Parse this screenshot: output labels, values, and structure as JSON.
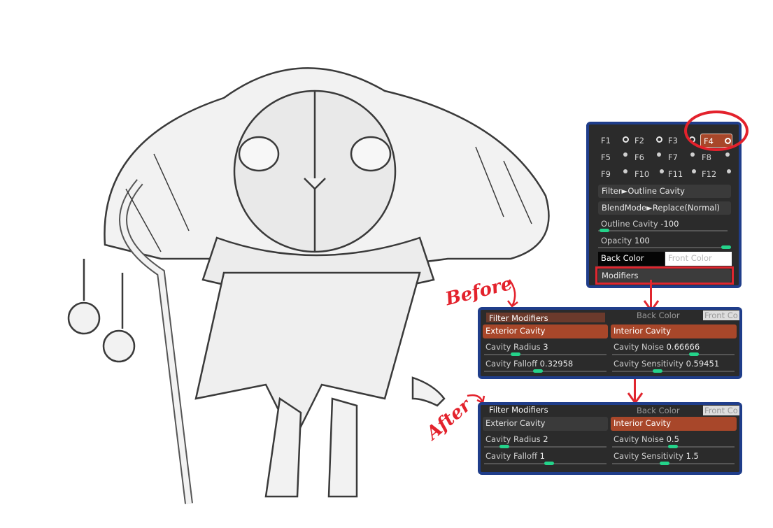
{
  "filter_panel": {
    "keys": [
      "F1",
      "F2",
      "F3",
      "F4",
      "F5",
      "F6",
      "F7",
      "F8",
      "F9",
      "F10",
      "F11",
      "F12"
    ],
    "filter": "Filter►Outline Cavity",
    "blendmode": "BlendMode►Replace(Normal)",
    "outline_label": "Outline Cavity",
    "outline_value": "-100",
    "opacity_label": "Opacity",
    "opacity_value": "100",
    "back_color": "Back Color",
    "front_color": "Front Color",
    "modifiers": "Modifiers"
  },
  "before": {
    "annotation": "Before",
    "ghost_back": "Back Color",
    "ghost_front": "Front Co",
    "title": "Filter Modifiers",
    "exterior": "Exterior Cavity",
    "interior": "Interior Cavity",
    "radius_label": "Cavity Radius",
    "radius_value": "3",
    "noise_label": "Cavity Noise",
    "noise_value": "0.66666",
    "falloff_label": "Cavity Falloff",
    "falloff_value": "0.32958",
    "sensitivity_label": "Cavity Sensitivity",
    "sensitivity_value": "0.59451"
  },
  "after": {
    "annotation": "After",
    "ghost_back": "Back Color",
    "ghost_front": "Front Co",
    "title": "Filter Modifiers",
    "exterior": "Exterior Cavity",
    "interior": "Interior Cavity",
    "radius_label": "Cavity Radius",
    "radius_value": "2",
    "noise_label": "Cavity Noise",
    "noise_value": "0.5",
    "falloff_label": "Cavity Falloff",
    "falloff_value": "1",
    "sensitivity_label": "Cavity Sensitivity",
    "sensitivity_value": "1.5"
  },
  "colors": {
    "accent_orange": "#a8472a",
    "slider_green": "#24d38a",
    "annotation_red": "#e3222c",
    "panel_border": "#1f3d8a"
  }
}
